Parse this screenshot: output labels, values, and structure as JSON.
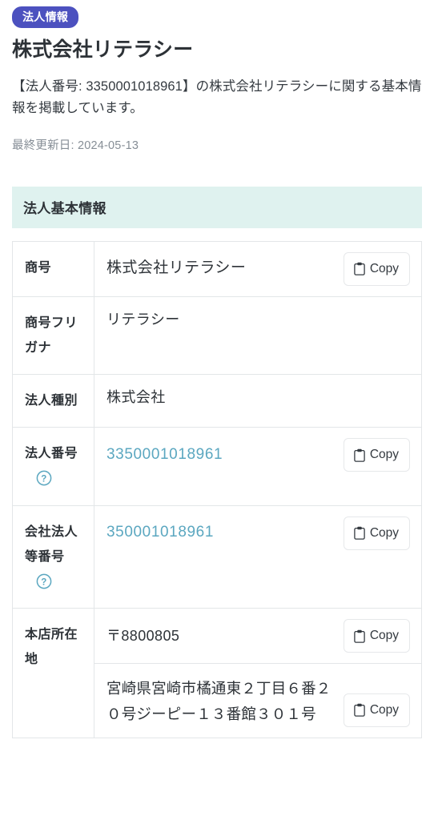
{
  "header": {
    "badge": "法人情報",
    "title": "株式会社リテラシー",
    "description": "【法人番号: 3350001018961】の株式会社リテラシーに関する基本情報を掲載しています。",
    "updated_label": "最終更新日: 2024-05-13"
  },
  "section": {
    "heading": "法人基本情報"
  },
  "copy_label": "Copy",
  "rows": {
    "trade_name": {
      "label": "商号",
      "value": "株式会社リテラシー"
    },
    "trade_name_kana": {
      "label": "商号フリガナ",
      "value": "リテラシー"
    },
    "corporate_type": {
      "label": "法人種別",
      "value": "株式会社"
    },
    "corporate_number": {
      "label": "法人番号",
      "value": "3350001018961"
    },
    "company_number": {
      "label": "会社法人等番号",
      "value": "350001018961"
    },
    "head_office": {
      "label": "本店所在地",
      "postal_code": "〒8800805",
      "address": "宮崎県宮崎市橘通東２丁目６番２０号ジーピー１３番館３０１号"
    }
  },
  "colors": {
    "badge_bg": "#4c51bf",
    "section_bg": "#dff2ef",
    "link": "#5ba7c0",
    "help_icon": "#5ba7c0",
    "border": "#e3e6e8",
    "text": "#2d3237",
    "muted": "#868e96"
  },
  "icons": {
    "copy": "clipboard-icon",
    "help": "question-circle-icon"
  }
}
